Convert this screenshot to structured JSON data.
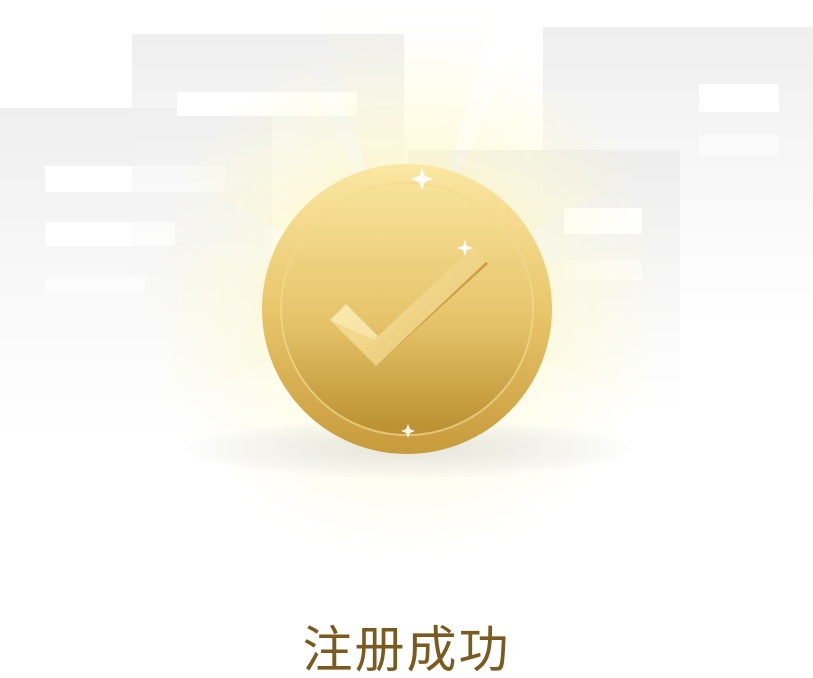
{
  "page": {
    "title": "注册成功"
  },
  "illustration": {
    "icon": "check-coin-icon",
    "colors": {
      "coin_light": "#f6dd8c",
      "coin_mid": "#e3bd5e",
      "coin_dark": "#b98f2f",
      "text": "#7a5a1f",
      "glow": "#fff3a8"
    }
  }
}
